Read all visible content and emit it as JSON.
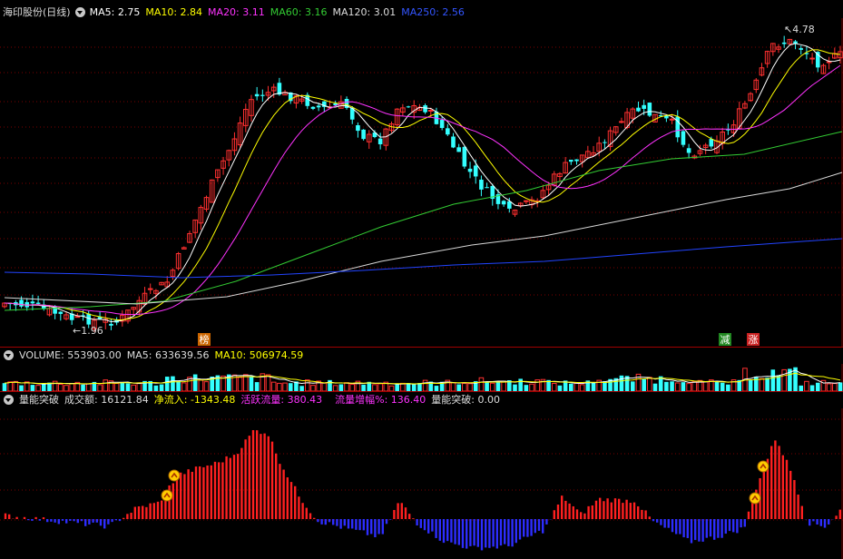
{
  "price_panel": {
    "title": "海印股份(日线)",
    "indicators": [
      {
        "label": "MA5:",
        "value": "2.75",
        "color": "#ffffff"
      },
      {
        "label": "MA10:",
        "value": "2.84",
        "color": "#ffff00"
      },
      {
        "label": "MA20:",
        "value": "3.11",
        "color": "#ff33ff"
      },
      {
        "label": "MA60:",
        "value": "3.16",
        "color": "#33cc33"
      },
      {
        "label": "MA120:",
        "value": "3.01",
        "color": "#dddddd"
      },
      {
        "label": "MA250:",
        "value": "2.56",
        "color": "#3355ff"
      }
    ],
    "high_label": "4.78",
    "low_label": "1.96",
    "markers": [
      {
        "text": "榜",
        "bg": "#cc6600"
      },
      {
        "text": "减",
        "bg": "#228822"
      },
      {
        "text": "涨",
        "bg": "#cc2222"
      }
    ],
    "colors": {
      "up": "#ff3030",
      "down": "#33ffff"
    }
  },
  "volume_panel": {
    "label": "VOLUME:",
    "value": "553903.00",
    "ma5_label": "MA5:",
    "ma5_value": "633639.56",
    "ma10_label": "MA10:",
    "ma10_value": "506974.59"
  },
  "indicator_panel": {
    "name": "量能突破",
    "fields": [
      {
        "label": "成交额:",
        "value": "16121.84",
        "color": "#dddddd"
      },
      {
        "label": "净流入:",
        "value": "-1343.48",
        "color": "#ffff00"
      },
      {
        "label": "活跃流量:",
        "value": "380.43",
        "color": "#ff33ff"
      },
      {
        "label": "流量增幅%:",
        "value": "136.40",
        "color": "#ff33ff"
      },
      {
        "label": "量能突破:",
        "value": "0.00",
        "color": "#dddddd"
      }
    ]
  }
}
